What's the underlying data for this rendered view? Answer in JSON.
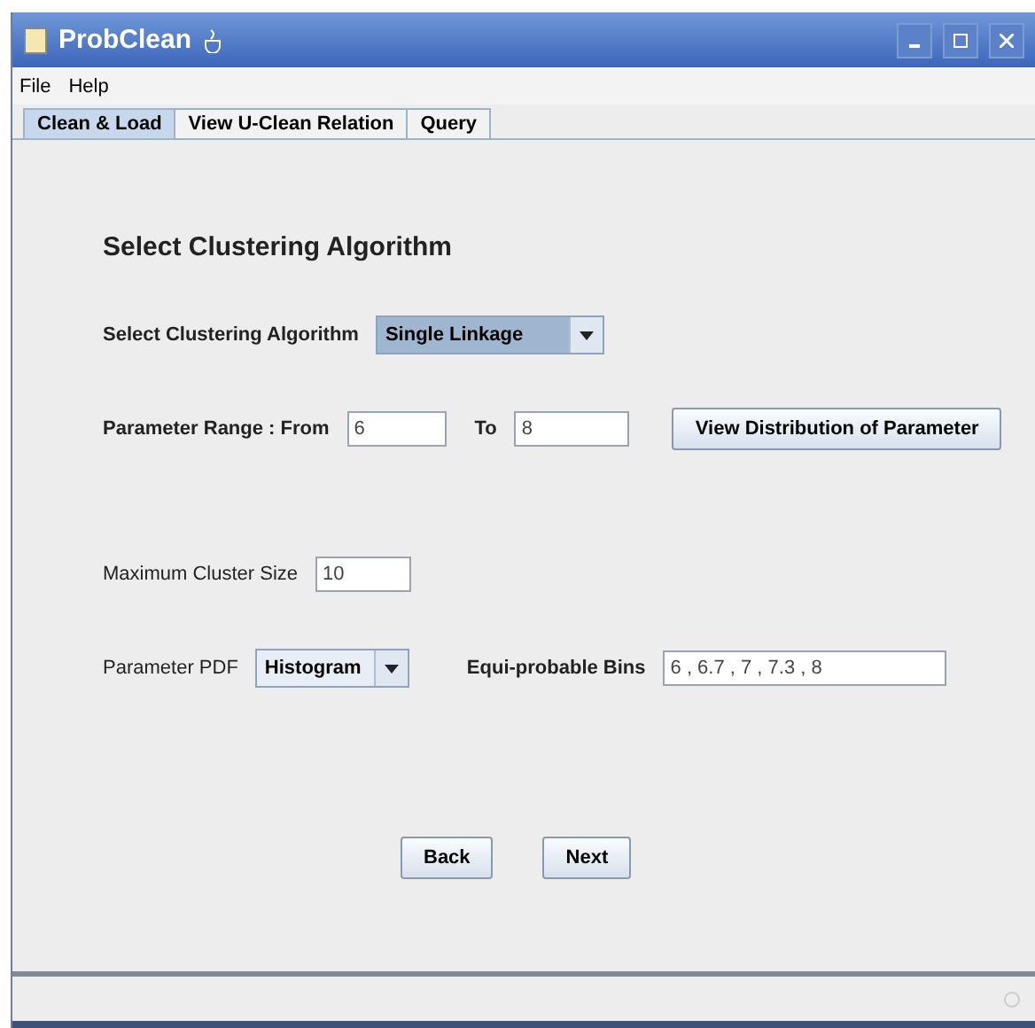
{
  "window": {
    "title": "ProbClean"
  },
  "menu": [
    "File",
    "Help"
  ],
  "tabs": [
    {
      "label": "Clean & Load",
      "selected": true
    },
    {
      "label": "View U-Clean Relation",
      "selected": false
    },
    {
      "label": "Query",
      "selected": false
    }
  ],
  "heading": "Select Clustering Algorithm",
  "algorithm": {
    "label": "Select Clustering Algorithm",
    "value": "Single Linkage"
  },
  "range": {
    "label": "Parameter Range : From",
    "from": "6",
    "to_label": "To",
    "to": "8",
    "button": "View Distribution of Parameter"
  },
  "cluster_size": {
    "label": "Maximum Cluster Size",
    "value": "10"
  },
  "pdf": {
    "label": "Parameter PDF",
    "value": "Histogram",
    "bins_label": "Equi-probable Bins",
    "bins": "6 , 6.7 , 7 , 7.3 , 8"
  },
  "buttons": [
    "Back",
    "Next"
  ]
}
